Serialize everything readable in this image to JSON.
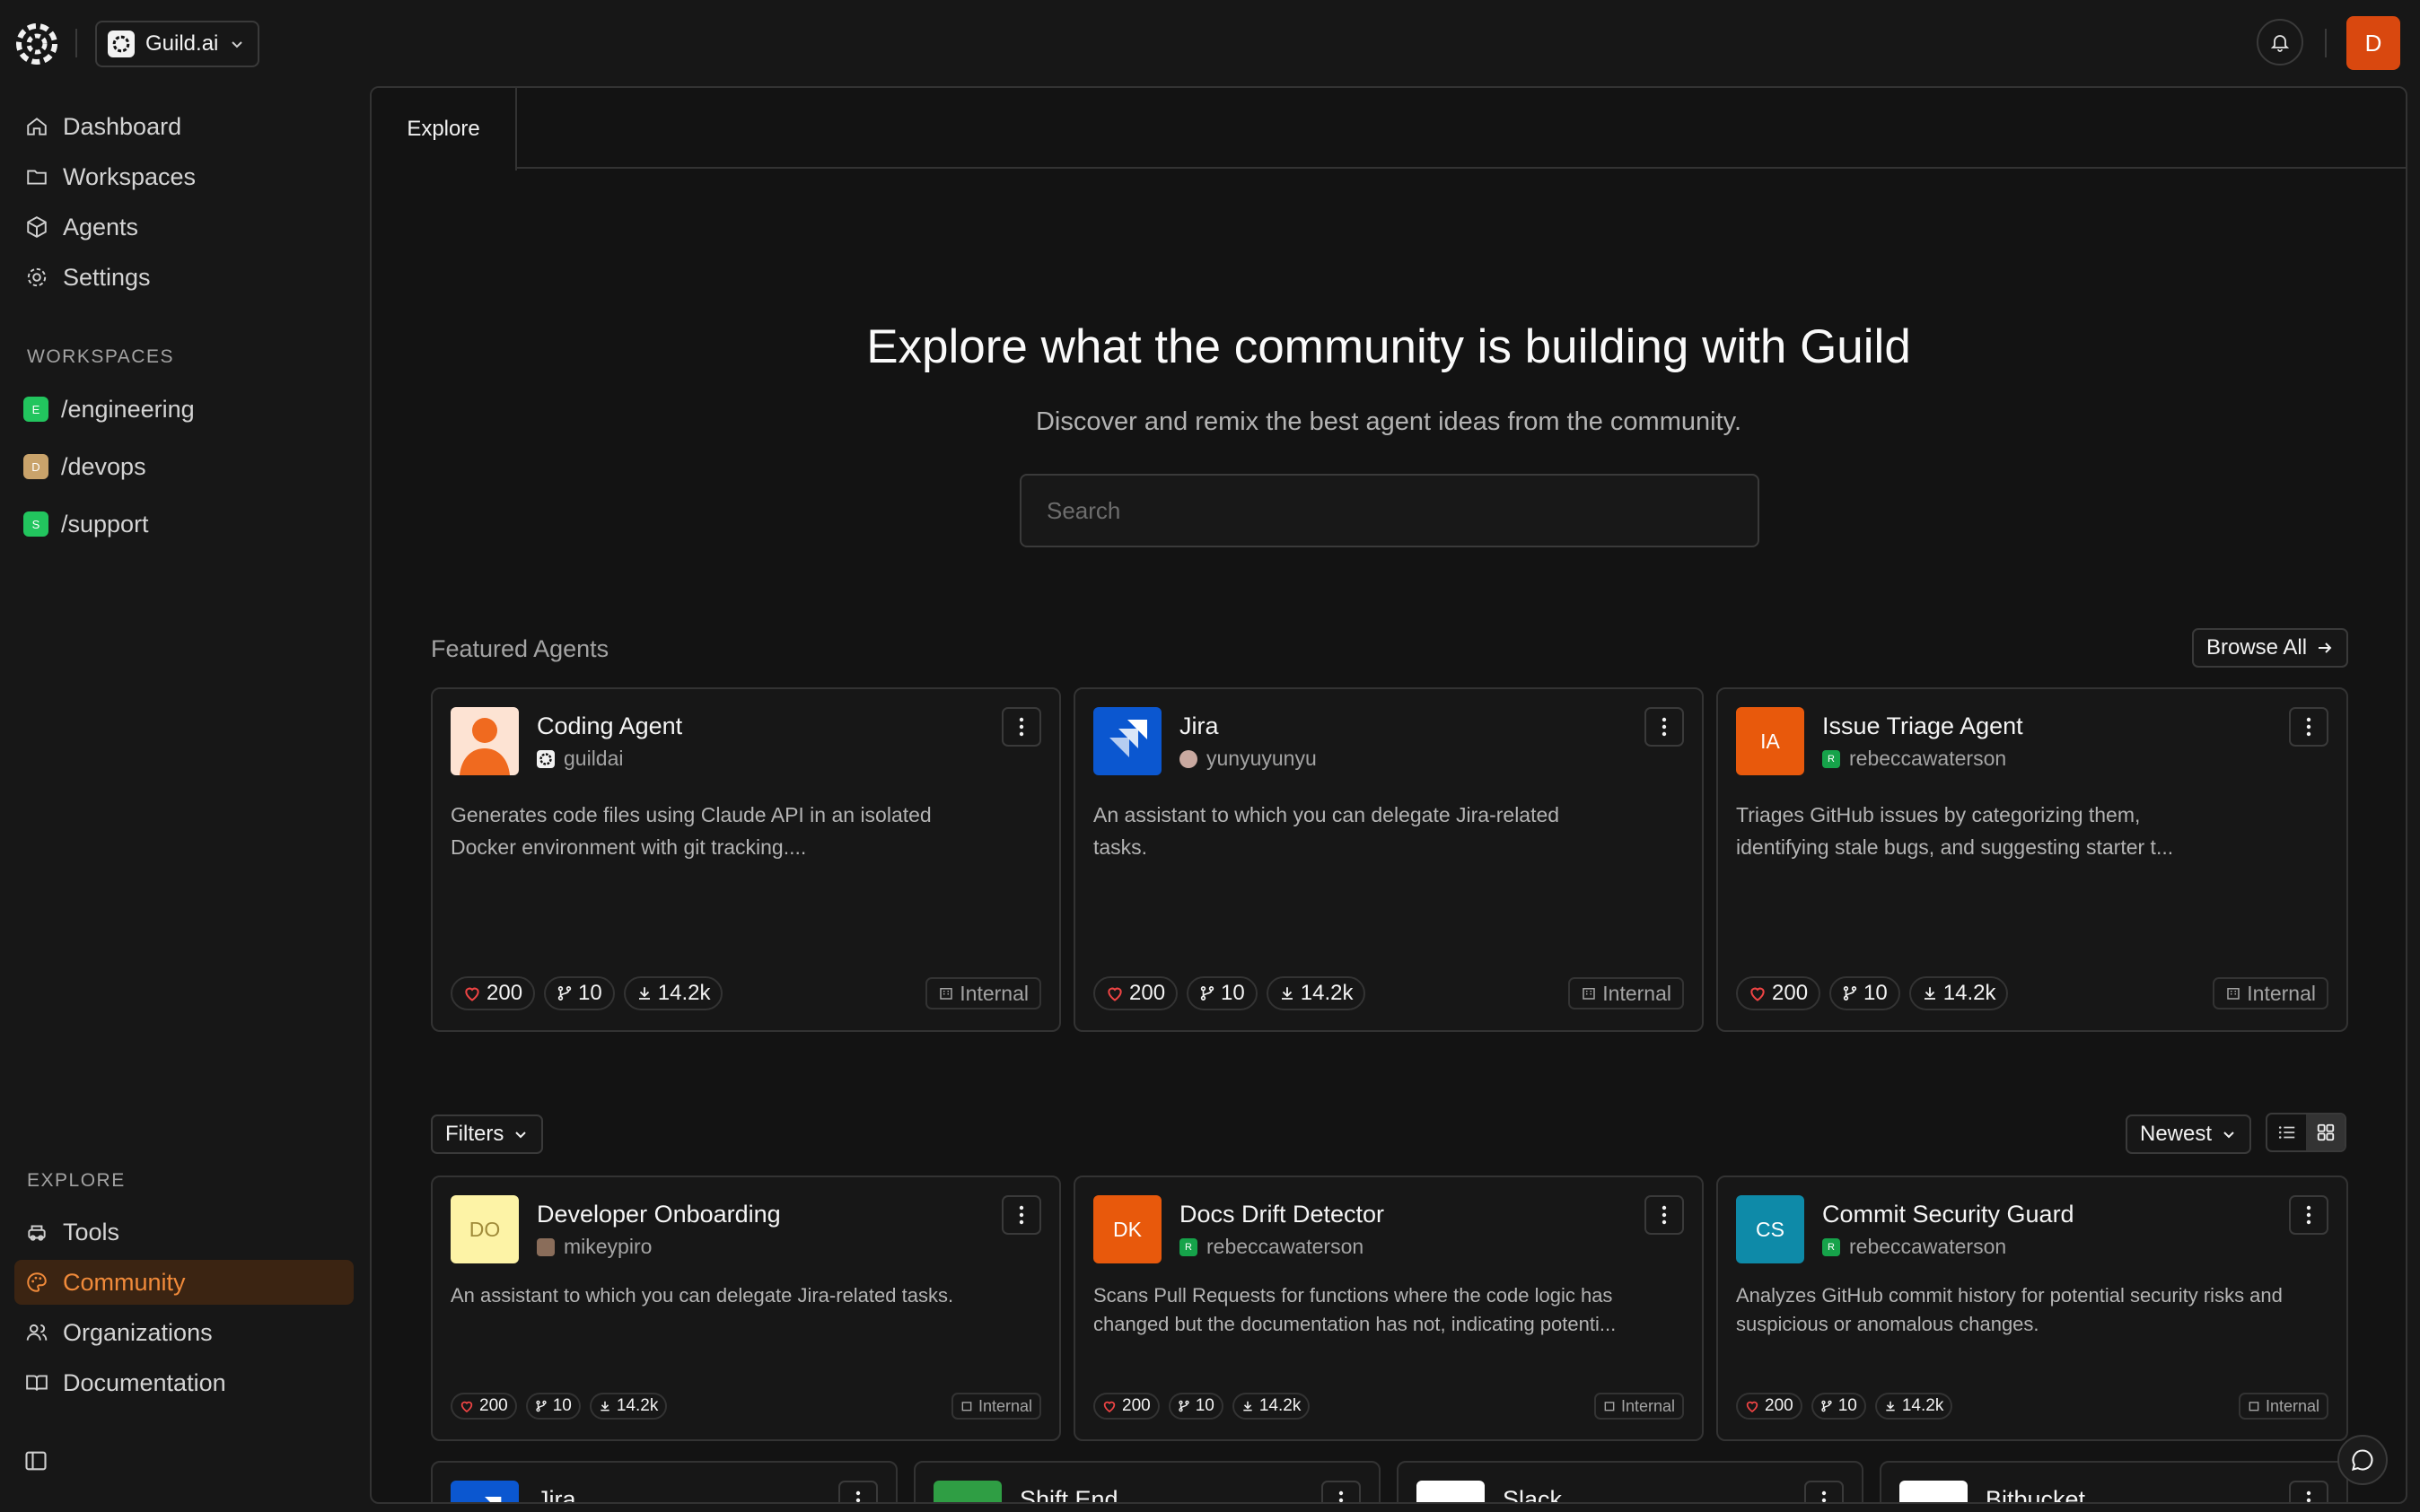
{
  "topbar": {
    "org_name": "Guild.ai",
    "avatar_initial": "D"
  },
  "sidebar": {
    "nav": [
      {
        "label": "Dashboard",
        "icon": "home-icon"
      },
      {
        "label": "Workspaces",
        "icon": "folder-icon"
      },
      {
        "label": "Agents",
        "icon": "cube-icon"
      },
      {
        "label": "Settings",
        "icon": "gear-icon"
      }
    ],
    "workspaces_heading": "WORKSPACES",
    "workspaces": [
      {
        "badge": "E",
        "label": "/engineering",
        "color": "#22c55e"
      },
      {
        "badge": "D",
        "label": "/devops",
        "color": "#c9a36b"
      },
      {
        "badge": "S",
        "label": "/support",
        "color": "#22c55e"
      }
    ],
    "explore_heading": "EXPLORE",
    "explore": [
      {
        "label": "Tools",
        "icon": "tools-icon"
      },
      {
        "label": "Community",
        "icon": "palette-icon",
        "active": true
      },
      {
        "label": "Organizations",
        "icon": "users-icon"
      },
      {
        "label": "Documentation",
        "icon": "book-icon"
      }
    ]
  },
  "tabs": [
    {
      "label": "Explore"
    }
  ],
  "hero": {
    "title": "Explore what the community is building with Guild",
    "subtitle": "Discover and remix the best agent ideas from the community.",
    "search_placeholder": "Search"
  },
  "featured": {
    "title": "Featured Agents",
    "browse_all": "Browse All",
    "cards": [
      {
        "name": "Coding Agent",
        "author": "guildai",
        "desc": "Generates code files using Claude API in an isolated Docker environment with git tracking....",
        "likes": "200",
        "forks": "10",
        "downloads": "14.2k",
        "tag": "Internal",
        "thumb_bg": "#fde3d3"
      },
      {
        "name": "Jira",
        "author": "yunyuyunyu",
        "desc": "An assistant to which you can delegate Jira-related tasks.",
        "likes": "200",
        "forks": "10",
        "downloads": "14.2k",
        "tag": "Internal",
        "thumb_bg": "#0b57d0"
      },
      {
        "name": "Issue Triage Agent",
        "author": "rebeccawaterson",
        "initials": "IA",
        "desc": "Triages GitHub issues by categorizing them, identifying stale bugs, and suggesting starter t...",
        "likes": "200",
        "forks": "10",
        "downloads": "14.2k",
        "tag": "Internal",
        "thumb_bg": "#e8590c"
      }
    ]
  },
  "controls": {
    "filters": "Filters",
    "sort": "Newest"
  },
  "grid": {
    "cards": [
      {
        "name": "Developer Onboarding",
        "author": "mikeypiro",
        "initials": "DO",
        "desc": "An assistant to which you can delegate Jira-related tasks.",
        "likes": "200",
        "forks": "10",
        "downloads": "14.2k",
        "tag": "Internal",
        "thumb_bg": "#fdf3a6",
        "thumb_fg": "#a08b3a"
      },
      {
        "name": "Docs Drift Detector",
        "author": "rebeccawaterson",
        "initials": "DK",
        "desc": "Scans Pull Requests for functions where the code logic has changed but the documentation has not, indicating potenti...",
        "likes": "200",
        "forks": "10",
        "downloads": "14.2k",
        "tag": "Internal",
        "thumb_bg": "#e8590c",
        "thumb_fg": "#ffffff"
      },
      {
        "name": "Commit Security Guard",
        "author": "rebeccawaterson",
        "initials": "CS",
        "desc": "Analyzes GitHub commit history for potential security risks and suspicious or anomalous changes.",
        "likes": "200",
        "forks": "10",
        "downloads": "14.2k",
        "tag": "Internal",
        "thumb_bg": "#0e8aa8",
        "thumb_fg": "#ffffff"
      }
    ],
    "bottom_row": [
      {
        "name": "Jira",
        "thumb_bg": "#0b57d0"
      },
      {
        "name": "Shift End",
        "thumb_bg": "#2f9e44"
      },
      {
        "name": "Slack",
        "thumb_bg": "#ffffff"
      },
      {
        "name": "Bitbucket",
        "thumb_bg": "#ffffff"
      }
    ]
  }
}
